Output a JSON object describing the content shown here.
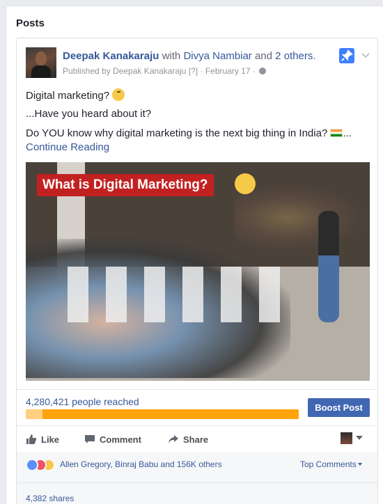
{
  "section": {
    "title": "Posts"
  },
  "post": {
    "author": "Deepak Kanakaraju",
    "with_label": "with",
    "tagged": "Divya Nambiar",
    "and_label": "and",
    "others": "2 others.",
    "published_by": "Published by Deepak Kanakaraju",
    "help": "[?]",
    "dot": "·",
    "date": "February 17",
    "lines": [
      "Digital marketing?",
      "...Have you heard about it?",
      "Do YOU know why digital marketing is the next big thing in India?",
      "..."
    ],
    "continue_label": "Continue Reading",
    "image_banner": "What is Digital Marketing?"
  },
  "insights": {
    "reach": "4,280,421 people reached",
    "organic_fraction": 0.06,
    "boost_label": "Boost Post"
  },
  "actions": {
    "like": "Like",
    "comment": "Comment",
    "share": "Share"
  },
  "reactions": {
    "summary": "Allen Gregory, Binraj Babu and 156K others",
    "top_comments": "Top Comments"
  },
  "shares": "4,382 shares",
  "colors": {
    "link": "#365899",
    "boost": "#4267b2",
    "paid_bar": "#ffa40b",
    "organic_bar": "#ffd080",
    "banner": "#c22121"
  },
  "icons": [
    "pin-icon",
    "chevron-down-icon",
    "globe-icon",
    "thinking-emoji",
    "india-flag",
    "like-icon",
    "comment-icon",
    "share-icon",
    "like-reaction",
    "love-reaction",
    "wow-reaction"
  ]
}
